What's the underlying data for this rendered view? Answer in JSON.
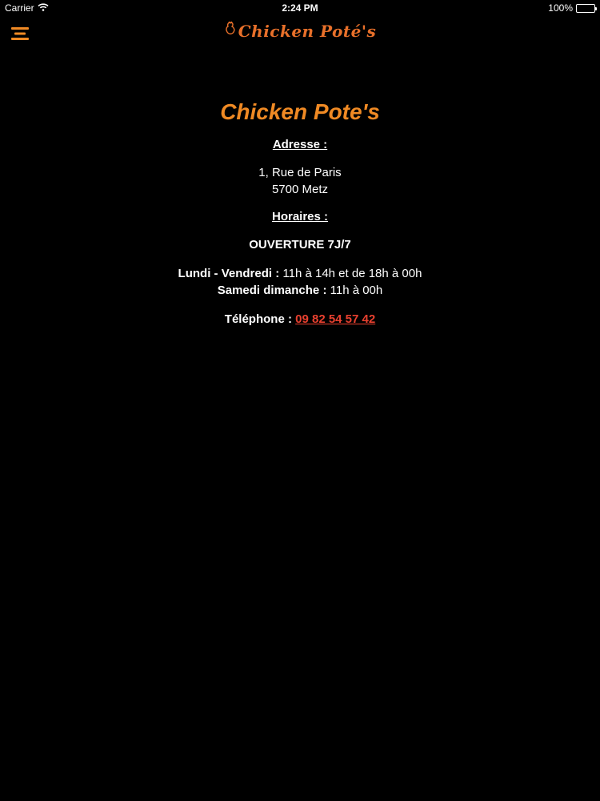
{
  "status_bar": {
    "carrier": "Carrier",
    "time": "2:24 PM",
    "battery": "100%"
  },
  "nav": {
    "logo_text": "Chicken Poté's"
  },
  "restaurant": {
    "name": "Chicken Pote's",
    "address_heading": "Adresse :",
    "address_line1": "1, Rue de Paris",
    "address_line2": "5700 Metz",
    "hours_heading": "Horaires :",
    "opening": "OUVERTURE 7J/7",
    "weekday_label": "Lundi - Vendredi :",
    "weekday_hours": "11h à 14h et de 18h à 00h",
    "weekend_label": "Samedi dimanche :",
    "weekend_hours": "11h à 00h",
    "phone_label": "Téléphone :",
    "phone_number": "09 82 54 57 42"
  },
  "colors": {
    "accent": "#f08a24",
    "link": "#e8402f",
    "background": "#000000"
  }
}
